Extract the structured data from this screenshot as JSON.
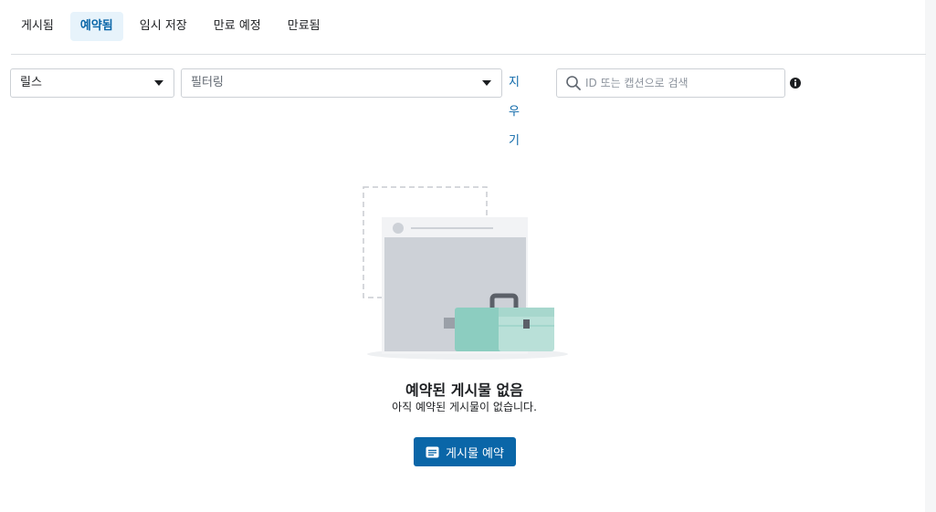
{
  "tabs": [
    {
      "label": "게시됨",
      "active": false
    },
    {
      "label": "예약됨",
      "active": true
    },
    {
      "label": "임시 저장",
      "active": false
    },
    {
      "label": "만료 예정",
      "active": false
    },
    {
      "label": "만료됨",
      "active": false
    }
  ],
  "toolbar": {
    "content_type_value": "릴스",
    "filter_value": "필터링",
    "clear_label": "지우기",
    "search_placeholder": "ID 또는 캡션으로 검색",
    "info_icon": "info-icon"
  },
  "empty_state": {
    "title": "예약된 게시물 없음",
    "subtitle": "아직 예약된 게시물이 없습니다.",
    "button_label": "게시물 예약",
    "button_icon": "post-icon"
  },
  "colors": {
    "accent": "#0a66a8",
    "active_tab_bg": "#e7f3fb",
    "toolbox_green": "#8ccdc0"
  }
}
